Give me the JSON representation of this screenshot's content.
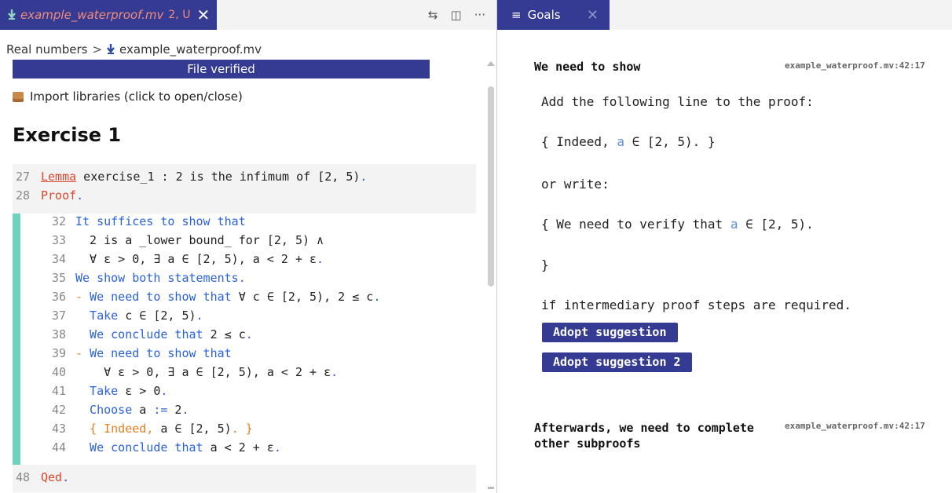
{
  "editor": {
    "tab": {
      "filename": "example_waterproof.mv",
      "badge": "2, U",
      "close": "✕"
    },
    "actions": {
      "compare": "⇆",
      "split": "◫",
      "more": "···"
    },
    "breadcrumb": {
      "folder": "Real numbers",
      "sep": ">",
      "file": "example_waterproof.mv"
    },
    "verified_banner": "File verified",
    "import_label": "Import libraries (click to open/close)",
    "heading": "Exercise 1",
    "code_lines": [
      {
        "n": "27",
        "segments": [
          {
            "t": "Lemma",
            "c": "red-u"
          },
          {
            "t": " exercise_1 : 2 is the infimum of [2, 5)",
            "c": "txt"
          },
          {
            "t": ".",
            "c": "kw"
          }
        ]
      },
      {
        "n": "28",
        "segments": [
          {
            "t": "Proof",
            "c": "red"
          },
          {
            "t": ".",
            "c": "kw"
          }
        ]
      },
      {
        "n": "32",
        "segments": [
          {
            "t": "It suffices to show that",
            "c": "kw"
          }
        ]
      },
      {
        "n": "33",
        "segments": [
          {
            "t": "  2 is a _lower bound_ for [2, 5) ∧",
            "c": "txt"
          }
        ]
      },
      {
        "n": "34",
        "segments": [
          {
            "t": "  ∀ ε > 0, ∃ a ∈ [2, 5), a < 2 + ε",
            "c": "txt"
          },
          {
            "t": ".",
            "c": "kw"
          }
        ]
      },
      {
        "n": "35",
        "segments": [
          {
            "t": "We show both statements.",
            "c": "kw"
          }
        ]
      },
      {
        "n": "36",
        "segments": [
          {
            "t": "- ",
            "c": "orange"
          },
          {
            "t": "We need to show that",
            "c": "kw"
          },
          {
            "t": " ∀ c ∈ [2, 5), 2 ≤ c",
            "c": "txt"
          },
          {
            "t": ".",
            "c": "kw"
          }
        ]
      },
      {
        "n": "37",
        "segments": [
          {
            "t": "  Take",
            "c": "kw"
          },
          {
            "t": " c ∈ [2, 5)",
            "c": "txt"
          },
          {
            "t": ".",
            "c": "kw"
          }
        ]
      },
      {
        "n": "38",
        "segments": [
          {
            "t": "  We conclude that",
            "c": "kw"
          },
          {
            "t": " 2 ≤ c",
            "c": "txt"
          },
          {
            "t": ".",
            "c": "kw"
          }
        ]
      },
      {
        "n": "39",
        "segments": [
          {
            "t": "- ",
            "c": "orange"
          },
          {
            "t": "We need to show that",
            "c": "kw"
          }
        ]
      },
      {
        "n": "40",
        "segments": [
          {
            "t": "    ∀ ε > 0, ∃ a ∈ [2, 5), a < 2 + ε",
            "c": "txt"
          },
          {
            "t": ".",
            "c": "kw"
          }
        ]
      },
      {
        "n": "41",
        "segments": [
          {
            "t": "  Take",
            "c": "kw"
          },
          {
            "t": " ε > 0",
            "c": "txt"
          },
          {
            "t": ".",
            "c": "kw"
          }
        ]
      },
      {
        "n": "42",
        "segments": [
          {
            "t": "  Choose",
            "c": "kw"
          },
          {
            "t": " a ",
            "c": "txt"
          },
          {
            "t": ":=",
            "c": "kw"
          },
          {
            "t": " 2",
            "c": "txt"
          },
          {
            "t": ".",
            "c": "kw"
          }
        ]
      },
      {
        "n": "43",
        "segments": [
          {
            "t": "  { Indeed, ",
            "c": "orange"
          },
          {
            "t": "a ∈ [2, 5)",
            "c": "txt"
          },
          {
            "t": ". }",
            "c": "orange"
          }
        ]
      },
      {
        "n": "44",
        "segments": [
          {
            "t": "  We conclude that",
            "c": "kw"
          },
          {
            "t": " a < 2 + ε",
            "c": "txt"
          },
          {
            "t": ".",
            "c": "kw"
          }
        ]
      },
      {
        "n": "48",
        "segments": [
          {
            "t": "Qed",
            "c": "red"
          },
          {
            "t": ".",
            "c": "kw"
          }
        ]
      }
    ]
  },
  "goals": {
    "tab": {
      "icon": "≡",
      "label": "Goals",
      "close": "✕"
    },
    "goal1": {
      "title": "We need to show",
      "location": "example_waterproof.mv:42:17",
      "line1": "Add the following line to the proof:",
      "line2_pre": "{ Indeed, ",
      "line2_var": "a",
      "line2_post": " ∈ [2, 5). }",
      "line3": "or write:",
      "line4_pre": "{ We need to verify that ",
      "line4_var": "a",
      "line4_post": " ∈ [2, 5).",
      "line5": "}",
      "line6": "if intermediary proof steps are required.",
      "button1": "Adopt suggestion",
      "button2": "Adopt suggestion 2"
    },
    "goal2": {
      "title_line1": "Afterwards, we need to complete",
      "title_line2": "other subproofs",
      "location": "example_waterproof.mv:42:17"
    }
  }
}
